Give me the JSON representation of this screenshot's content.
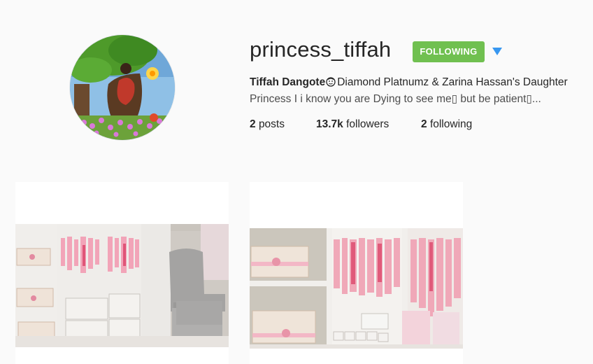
{
  "profile": {
    "username": "princess_tiffah",
    "follow_button_label": "FOLLOWING",
    "full_name": "Tiffah Dangote",
    "bio_line1": "Diamond Platnumz & Zarina Hassan's Daughter",
    "bio_line2": "Princess I i know you are Dying to see me▯ but be patient▯...",
    "stats": {
      "posts": {
        "count": "2",
        "label": "posts"
      },
      "followers": {
        "count": "13.7k",
        "label": "followers"
      },
      "following": {
        "count": "2",
        "label": "following"
      }
    }
  },
  "icons": {
    "dropdown": "triangle-down-icon",
    "bio_emoji": "baby-face-icon"
  },
  "colors": {
    "following_button": "#70c050",
    "dropdown_arrow": "#3897f0",
    "background": "#fafafa"
  },
  "posts": [
    {
      "subject": "nursery closet with pink baby clothes and grey armchair"
    },
    {
      "subject": "closeup of pink baby clothes closet"
    }
  ]
}
